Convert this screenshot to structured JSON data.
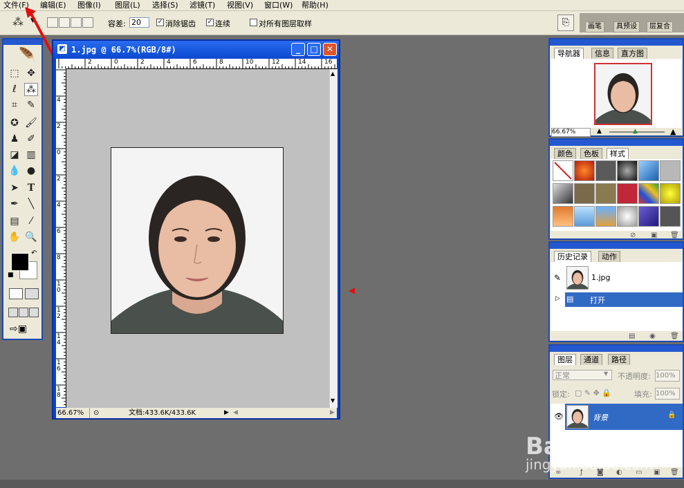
{
  "menu": [
    "文件(F)",
    "编辑(E)",
    "图像(I)",
    "图层(L)",
    "选择(S)",
    "滤镜(T)",
    "视图(V)",
    "窗口(W)",
    "帮助(H)"
  ],
  "options": {
    "tolerance_label": "容差:",
    "tolerance_value": "20",
    "antialias_label": "消除锯齿",
    "contiguous_label": "连续",
    "sample_all_label": "对所有图层取样",
    "palette_tabs": [
      "画笔",
      "具预设",
      "层复合"
    ]
  },
  "document": {
    "title": "1.jpg @ 66.7%(RGB/8#)",
    "zoom": "66.67%",
    "doc_info": "文档:433.6K/433.6K",
    "ruler_top": [
      "2",
      "0",
      "2",
      "4",
      "6",
      "8",
      "10",
      "12",
      "14",
      "16"
    ],
    "ruler_left": [
      "4",
      "2",
      "0",
      "2",
      "4",
      "6",
      "8",
      "10",
      "12",
      "14",
      "16",
      "18"
    ]
  },
  "navigator": {
    "tabs": [
      "导航器",
      "信息",
      "直方图"
    ],
    "zoom": "66.67%"
  },
  "swatches": {
    "tabs": [
      "颜色",
      "色板",
      "样式"
    ]
  },
  "history": {
    "tabs": [
      "历史记录",
      "动作"
    ],
    "snapshot": "1.jpg",
    "step": "打开"
  },
  "layers": {
    "tabs": [
      "图层",
      "通道",
      "路径"
    ],
    "blend_mode": "正常",
    "opacity_label": "不透明度:",
    "opacity_value": "100%",
    "lock_label": "锁定:",
    "fill_label": "填充:",
    "fill_value": "100%",
    "layer_name": "背景"
  },
  "watermark": {
    "brand": "Bai du 经验",
    "url": "jingyan.baidu.com"
  },
  "colors": {
    "title_blue": "#0848d0",
    "selection_blue": "#316ac5",
    "annotation_red": "#e01010"
  }
}
